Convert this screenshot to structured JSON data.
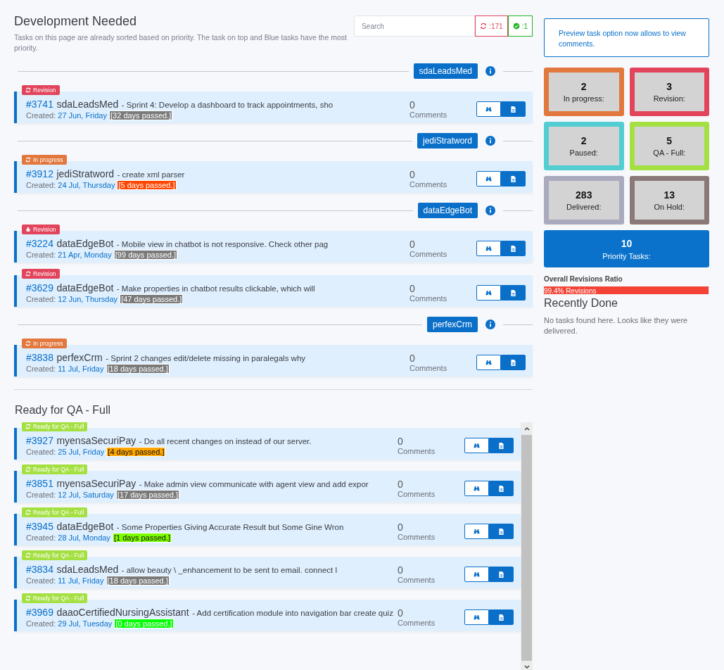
{
  "header": {
    "title": "Development Needed",
    "subtitle": "Tasks on this page are already sorted based on priority. The task on top and Blue tasks have the most priority.",
    "search": {
      "placeholder": "Search"
    },
    "counters": [
      {
        "kind": "refresh",
        "text": ":171",
        "color": "#e2445c"
      },
      {
        "kind": "check",
        "text": ":1",
        "color": "#1fb51f"
      }
    ]
  },
  "groups": [
    {
      "project": "sdaLeadsMed",
      "tasks": [
        {
          "status": {
            "kind": "revision",
            "label": "Revision"
          },
          "id": "#3741",
          "project": "sdaLeadsMed",
          "title": "- Sprint 4: Develop a dashboard to track appointments, sho",
          "created_label": "Created:",
          "created": "27 Jun, Friday",
          "age": {
            "text": "[32 days passed.]",
            "color": "#7a7a7a"
          },
          "comments": "0",
          "comments_label": "Comments"
        }
      ]
    },
    {
      "project": "jediStratword",
      "tasks": [
        {
          "status": {
            "kind": "in_progress",
            "label": "In progress"
          },
          "id": "#3912",
          "project": "jediStratword",
          "title": "- create xml parser",
          "created_label": "Created:",
          "created": "24 Jul, Thursday",
          "age": {
            "text": "[5 days passed.]",
            "color": "#ff4500"
          },
          "comments": "0",
          "comments_label": "Comments"
        }
      ]
    },
    {
      "project": "dataEdgeBot",
      "tasks": [
        {
          "status": {
            "kind": "bug",
            "label": "Revision"
          },
          "id": "#3224",
          "project": "dataEdgeBot",
          "title": "- Mobile view in chatbot is not responsive. Check other pag",
          "created_label": "Created:",
          "created": "21 Apr, Monday",
          "age": {
            "text": "[99 days passed.]",
            "color": "#7a7a7a"
          },
          "comments": "0",
          "comments_label": "Comments"
        },
        {
          "status": {
            "kind": "revision",
            "label": "Revision"
          },
          "id": "#3629",
          "project": "dataEdgeBot",
          "title": "- Make properties in chatbot results clickable, which will",
          "created_label": "Created:",
          "created": "12 Jun, Thursday",
          "age": {
            "text": "[47 days passed.]",
            "color": "#7a7a7a"
          },
          "comments": "0",
          "comments_label": "Comments"
        }
      ]
    },
    {
      "project": "perfexCrm",
      "tasks": [
        {
          "status": {
            "kind": "in_progress",
            "label": "In progress"
          },
          "id": "#3838",
          "project": "perfexCrm",
          "title": "- Sprint 2 changes edit/delete missing in paralegals why",
          "created_label": "Created:",
          "created": "11 Jul, Friday",
          "age": {
            "text": "[18 days passed.]",
            "color": "#7a7a7a"
          },
          "comments": "0",
          "comments_label": "Comments"
        }
      ]
    }
  ],
  "qa": {
    "title": "Ready for QA - Full",
    "tasks": [
      {
        "status": {
          "kind": "qa",
          "label": "Ready for QA - Full"
        },
        "id": "#3927",
        "project": "myensaSecuriPay",
        "title": "- Do all recent changes on instead of our server.",
        "created_label": "Created:",
        "created": "25 Jul, Friday",
        "age": {
          "text": "[4 days passed.]",
          "color": "#ffa500"
        },
        "comments": "0",
        "comments_label": "Comments"
      },
      {
        "status": {
          "kind": "qa",
          "label": "Ready for QA - Full"
        },
        "id": "#3851",
        "project": "myensaSecuriPay",
        "title": "- Make admin view communicate with agent view and add expor",
        "created_label": "Created:",
        "created": "12 Jul, Saturday",
        "age": {
          "text": "[17 days passed.]",
          "color": "#7a7a7a"
        },
        "comments": "0",
        "comments_label": "Comments"
      },
      {
        "status": {
          "kind": "qa",
          "label": "Ready for QA - Full"
        },
        "id": "#3945",
        "project": "dataEdgeBot",
        "title": "- Some Properties Giving Accurate Result but Some Gine Wron",
        "created_label": "Created:",
        "created": "28 Jul, Monday",
        "age": {
          "text": "[1 days passed.]",
          "color": "#7cfc00"
        },
        "comments": "0",
        "comments_label": "Comments"
      },
      {
        "status": {
          "kind": "qa",
          "label": "Ready for QA - Full"
        },
        "id": "#3834",
        "project": "sdaLeadsMed",
        "title": "- allow beauty \\ _enhancement to be sent to email. connect l",
        "created_label": "Created:",
        "created": "11 Jul, Friday",
        "age": {
          "text": "[18 days passed.]",
          "color": "#7a7a7a"
        },
        "comments": "0",
        "comments_label": "Comments"
      },
      {
        "status": {
          "kind": "qa",
          "label": "Ready for QA - Full"
        },
        "id": "#3969",
        "project": "daaoCertifiedNursingAssistant",
        "title": "- Add certification module into navigation bar create quiz",
        "created_label": "Created:",
        "created": "29 Jul, Tuesday",
        "age": {
          "text": "[0 days passed.]",
          "color": "#00ff00"
        },
        "comments": "0",
        "comments_label": "Comments"
      }
    ]
  },
  "sidebar": {
    "notice": "Preview task option now allows to view comments.",
    "stats": [
      {
        "value": "2",
        "label": "In progress:",
        "color": "#e2783d"
      },
      {
        "value": "3",
        "label": "Revision:",
        "color": "#e2445c"
      },
      {
        "value": "2",
        "label": "Paused:",
        "color": "#52ced3"
      },
      {
        "value": "5",
        "label": "QA - Full:",
        "color": "#a5e043"
      },
      {
        "value": "283",
        "label": "Delivered:",
        "color": "#a9aabd"
      },
      {
        "value": "13",
        "label": "On Hold:",
        "color": "#8b7878"
      }
    ],
    "priority": {
      "value": "10",
      "label": "Priority Tasks:"
    },
    "ratio": {
      "title": "Overall Revisions Ratio",
      "label": "99.4% Revisions",
      "level": 0.994
    },
    "recent": {
      "title": "Recently Done",
      "text": "No tasks found here. Looks like they were delivered."
    }
  }
}
